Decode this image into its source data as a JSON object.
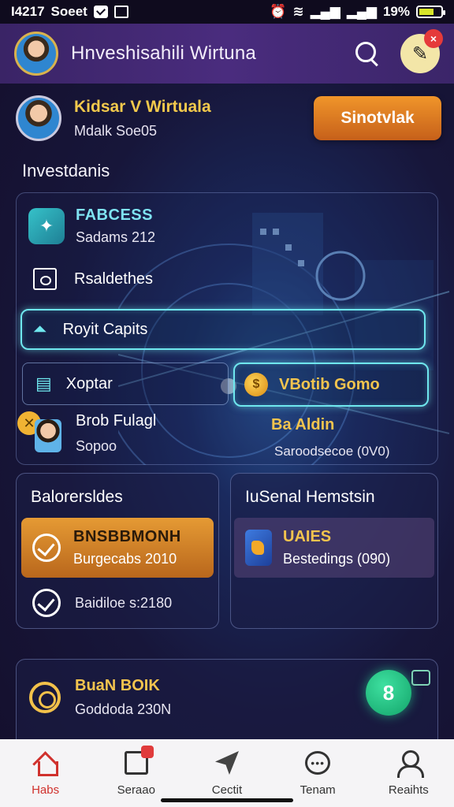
{
  "status_bar": {
    "time": "I4217",
    "carrier": "Soeet",
    "battery": "19%",
    "battery_level": 0.55
  },
  "header": {
    "title": "Hnveshisahili Wirtuna",
    "notification_count": "×"
  },
  "profile": {
    "name": "Kidsar V Wirtuala",
    "subtitle": "Mdalk Soe05",
    "cta_label": "Sinotvlak"
  },
  "investments": {
    "title": "Investdanis",
    "featured": {
      "title": "FABCESS",
      "subtitle": "Sadams 212"
    },
    "item1": "Rsaldethes",
    "item2": "Royit Capits",
    "item3": "Xoptar",
    "highlight": "VBotib Gomo",
    "person": {
      "name": "Brob Fulagl",
      "subtitle": "Sopoo"
    },
    "right_label": {
      "title": "Ba Aldin",
      "subtitle": "Saroodsecoe (0V0)"
    }
  },
  "card_left": {
    "title": "Balorersldes",
    "tile": {
      "title": "BNSBBMONH",
      "subtitle": "Burgecabs 2010"
    },
    "item": "Baidiloe s:2180"
  },
  "card_right": {
    "title": "IuSenal Hemstsin",
    "tile": {
      "title": "UAIES",
      "subtitle": "Bestedings (090)"
    }
  },
  "bottom_card": {
    "title": "BuaN BOIK",
    "subtitle": "Goddoda 230N",
    "fab_label": "8"
  },
  "nav": [
    {
      "label": "Habs",
      "icon": "home-icon",
      "active": true
    },
    {
      "label": "Seraao",
      "icon": "document-icon"
    },
    {
      "label": "Cectit",
      "icon": "plane-icon"
    },
    {
      "label": "Tenam",
      "icon": "chat-icon"
    },
    {
      "label": "Reaihts",
      "icon": "user-icon"
    }
  ],
  "colors": {
    "accent_orange": "#e8882a",
    "accent_cyan": "#6fe7ee",
    "accent_gold": "#f3c44e",
    "nav_active": "#d0312d",
    "header_purple": "#4a2c7e"
  }
}
